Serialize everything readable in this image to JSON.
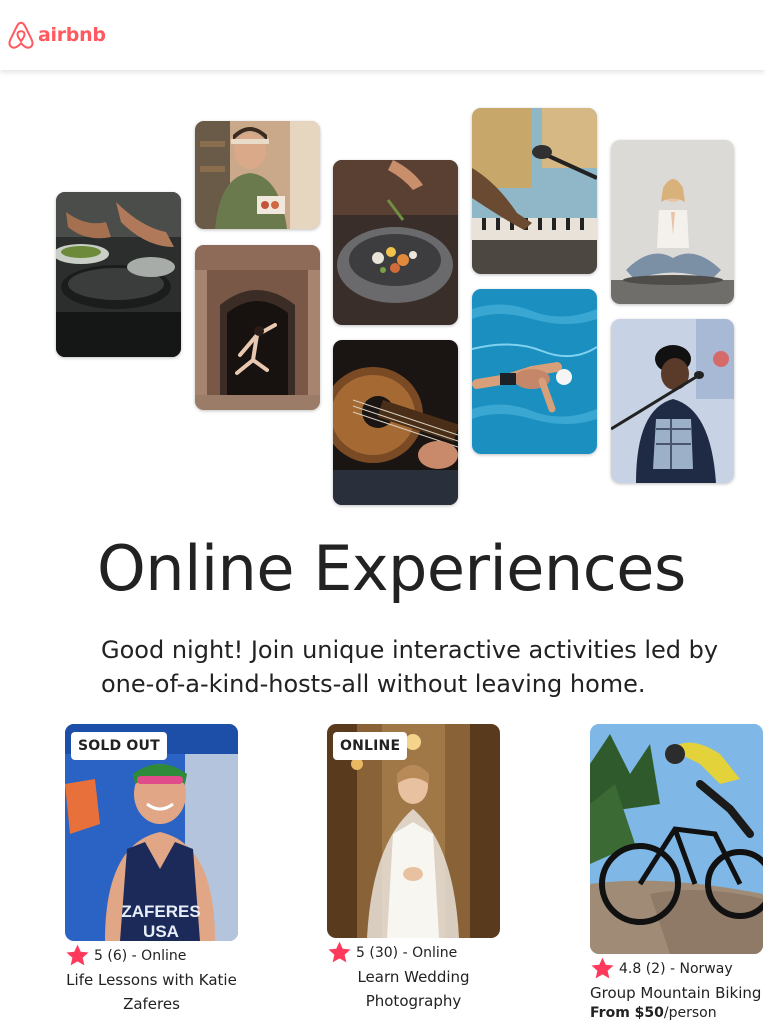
{
  "brand": {
    "name": "airbnb",
    "color": "#FF5A5F"
  },
  "hero": {
    "photos": [
      {
        "icon": "cooking-pans-photo"
      },
      {
        "icon": "chef-photo"
      },
      {
        "icon": "dancer-doorway-photo"
      },
      {
        "icon": "plated-dish-photo"
      },
      {
        "icon": "acoustic-guitar-photo"
      },
      {
        "icon": "keyboard-microphone-photo"
      },
      {
        "icon": "swimmer-photo"
      },
      {
        "icon": "yoga-photo"
      },
      {
        "icon": "singer-photo"
      }
    ],
    "title": "Online Experiences",
    "subtitle": "Good night! Join unique interactive activities led by one-of-a-kind-hosts-all without leaving home."
  },
  "cards": [
    {
      "badge": "SOLD OUT",
      "rating": "5",
      "reviews": "(6)",
      "location": "- Online",
      "title": "Life Lessons with Katie Zaferes",
      "price_prefix": "",
      "price_suffix": ""
    },
    {
      "badge": "ONLINE",
      "rating": "5",
      "reviews": "(30)",
      "location": "- Online",
      "title": "Learn Wedding Photography",
      "price_prefix": "",
      "price_suffix": ""
    },
    {
      "badge": "",
      "rating": "4.8",
      "reviews": "(2)",
      "location": "- Norway",
      "title": "Group Mountain Biking",
      "price_prefix": "From $50",
      "price_suffix": "/person"
    }
  ],
  "colors": {
    "accent": "#FF5A5F",
    "star": "#FE395C",
    "text": "#222222"
  }
}
